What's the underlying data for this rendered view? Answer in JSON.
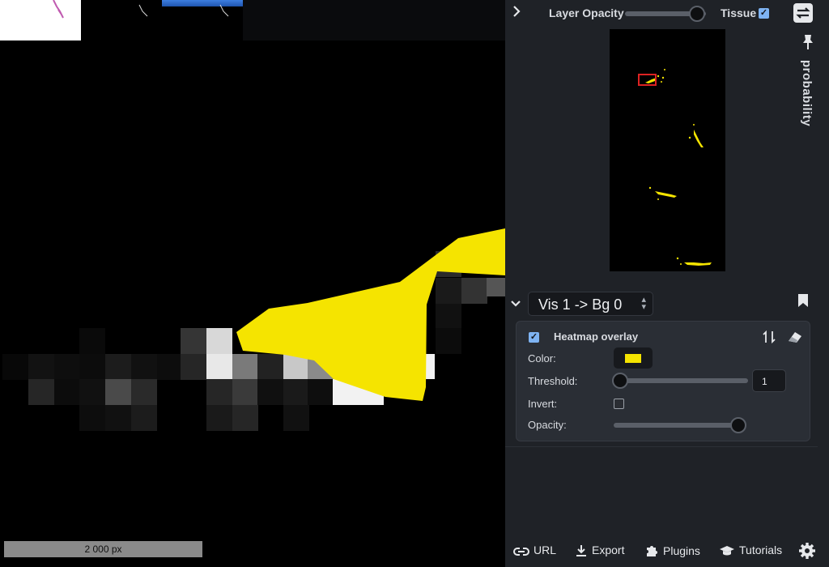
{
  "viewer": {
    "scale_bar": "2 000 px"
  },
  "panel": {
    "layer_opacity_label": "Layer Opacity",
    "layer_opacity_value": 0.9,
    "tissue_label": "Tissue",
    "tissue_checked": true,
    "probability_label": "probability",
    "vis_select_value": "Vis 1 -> Bg 0",
    "heatmap": {
      "title": "Heatmap overlay",
      "enabled": true,
      "color_label": "Color:",
      "color_value": "#f5e400",
      "threshold_label": "Threshold:",
      "threshold_value": "1",
      "invert_label": "Invert:",
      "invert_checked": false,
      "opacity_label": "Opacity:",
      "opacity_value": 0.98
    },
    "bottom_bar": {
      "url_label": "URL",
      "export_label": "Export",
      "plugins_label": "Plugins",
      "tutorials_label": "Tutorials"
    }
  },
  "colors": {
    "accent_yellow": "#f5e400",
    "panel_bg": "#1f2227",
    "card_bg": "#2a2e35",
    "overview_box": "#dd2222"
  }
}
